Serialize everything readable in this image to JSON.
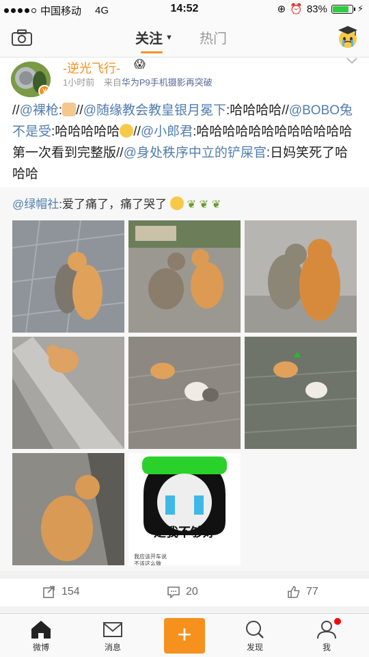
{
  "status": {
    "carrier": "中国移动",
    "network": "4G",
    "time": "14:52",
    "battery_percent": "83%",
    "battery_level": 0.83,
    "signal_bars": 4
  },
  "nav": {
    "tab_follow": "关注",
    "tab_hot": "热门",
    "accent": "#f6911e"
  },
  "post": {
    "username": "-逆光飞行-",
    "time": "1小时前",
    "source_prefix": "来自",
    "source": "华为P9手机摄影再突破",
    "text": {
      "p1": "//",
      "m1": "@裸枪",
      "p2": ":",
      "p3": "//",
      "m2": "@随缘教会教皇银月冕下",
      "p4": ":哈哈哈哈//",
      "m3": "@BOBO兔不是受",
      "p5": ":哈哈哈哈哈",
      "p6": "//",
      "m4": "@小郎君",
      "p7": ":哈哈哈哈哈哈哈哈哈哈哈哈第一次看到完整版//",
      "m5": "@身处秩序中立的铲屎官",
      "p8": ":日妈笑死了哈哈哈"
    },
    "repost": {
      "mention": "@绿帽社",
      "text": ":爱了痛了，痛了哭了"
    },
    "meme_caption": "是我不够好",
    "meme_small1": "我应该开车说",
    "meme_small2": "不该这么做"
  },
  "actions": {
    "repost_count": "154",
    "comment_count": "20",
    "like_count": "77"
  },
  "tabbar": {
    "home": "微博",
    "messages": "消息",
    "discover": "发现",
    "me": "我",
    "compose": "+"
  }
}
